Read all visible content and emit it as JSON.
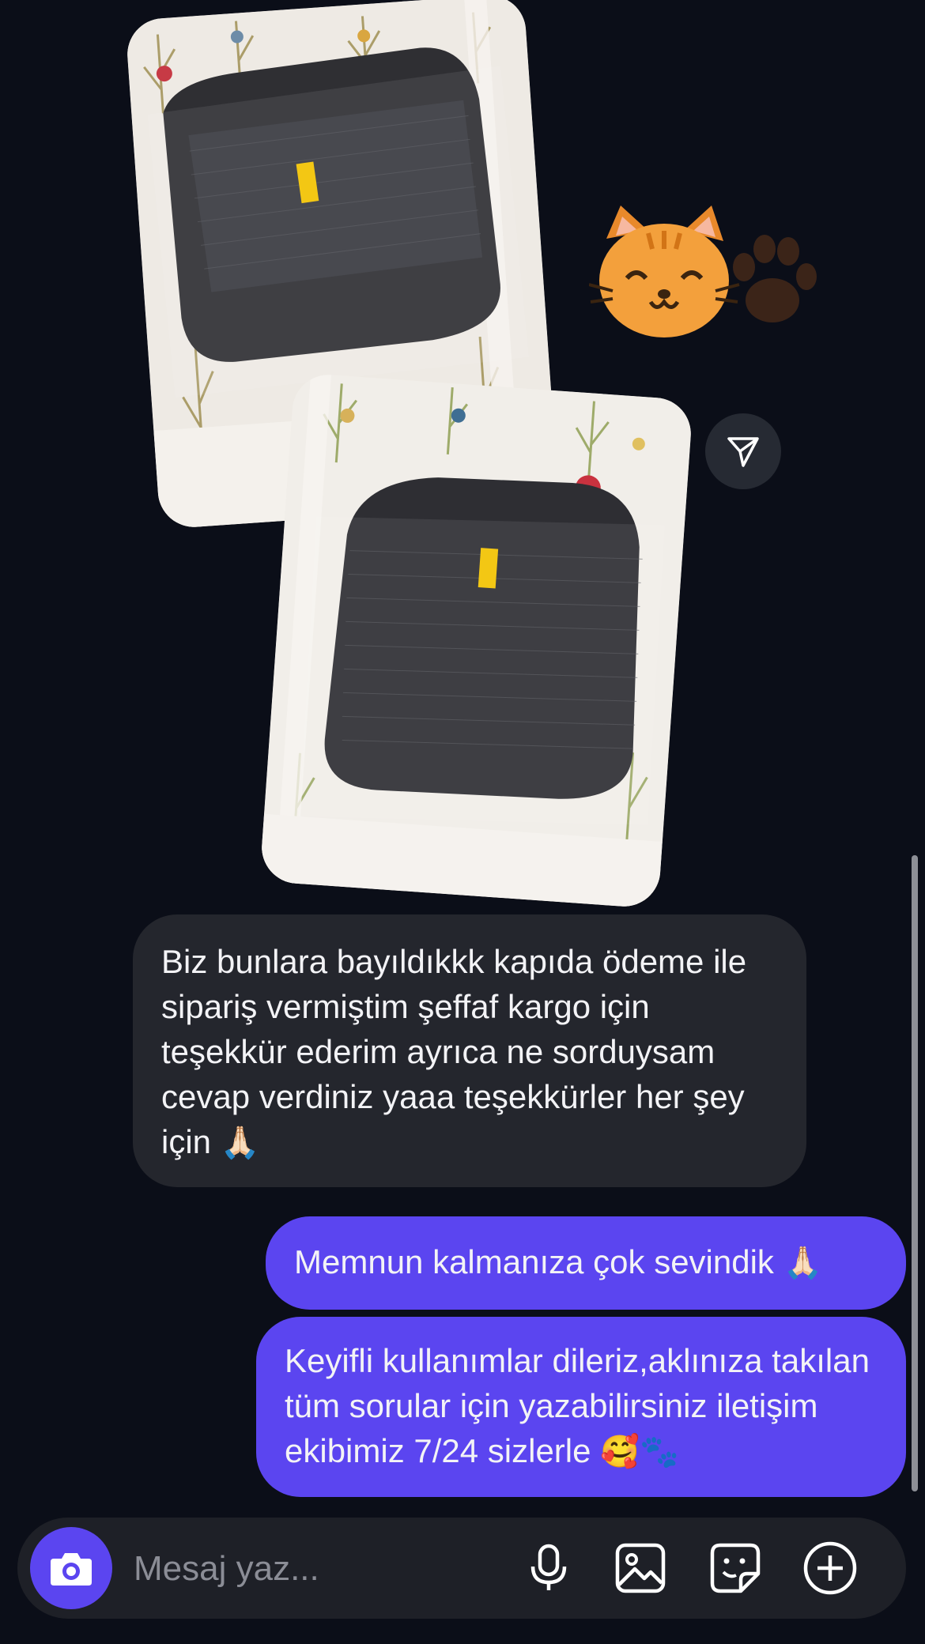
{
  "messages": {
    "incoming_text": "Biz bunlara bayıldıkkk kapıda ödeme ile sipariş vermiştim şeffaf kargo için teşekkür ederim ayrıca ne sorduysam cevap verdiniz yaaa teşekkürler her şey için",
    "incoming_emoji": "🙏🏻",
    "reply1_text": "Memnun kalmanıza çok sevindik",
    "reply1_emoji": "🙏🏻",
    "reply2_text": "Keyifli kullanımlar dileriz,aklınıza takılan tüm sorular için yazabilirsiniz iletişim ekibimiz 7/24 sizlerle",
    "reply2_emoji": "🥰🐾"
  },
  "sticker": {
    "name": "smiling-cat-with-paw-print",
    "emoji": "😸🐾"
  },
  "composer": {
    "placeholder": "Mesaj yaz..."
  },
  "icons": {
    "camera": "camera-icon",
    "mic": "microphone-icon",
    "gallery": "image-icon",
    "sticker": "sticker-icon",
    "plus": "plus-circle-icon",
    "share": "send-icon"
  },
  "colors": {
    "background": "#0b0e18",
    "incoming_bubble": "#24262d",
    "outgoing_bubble": "#5b45f0",
    "accent": "#5b45f0"
  }
}
